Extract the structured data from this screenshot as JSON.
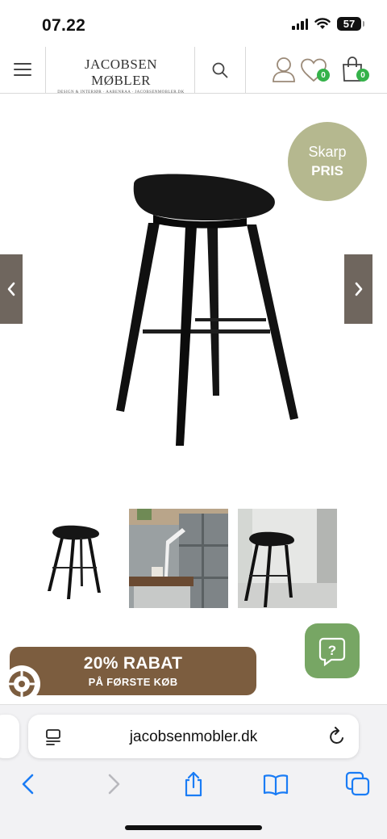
{
  "status_bar": {
    "time": "07.22",
    "battery": "57"
  },
  "header": {
    "logo_main": "JACOBSEN MØBLER",
    "logo_sub": "DESIGN & INTERIØR · AABENRAA · JACOBSENMOBLER.DK",
    "wishlist_count": "0",
    "cart_count": "0"
  },
  "product": {
    "badge_line1": "Skarp",
    "badge_line2": "PRIS",
    "thumbnail_count": 3
  },
  "promo": {
    "title": "20% RABAT",
    "subtitle": "PÅ FØRSTE KØB"
  },
  "help": {
    "label": "?"
  },
  "browser": {
    "url": "jacobsenmobler.dk"
  },
  "icons": [
    "menu-icon",
    "search-icon",
    "user-icon",
    "heart-icon",
    "bag-icon",
    "chevron-left-icon",
    "chevron-right-icon",
    "question-icon",
    "wheel-icon",
    "reader-icon",
    "reload-icon",
    "back-icon",
    "forward-icon",
    "share-icon",
    "bookmarks-icon",
    "tabs-icon"
  ],
  "colors": {
    "badge_bg": "#b5b88f",
    "arrow_bg": "#6f665e",
    "promo_bg": "#7c5d3f",
    "help_bg": "#77a664",
    "count_badge": "#35b24a",
    "safari_blue": "#1a7cf5"
  }
}
